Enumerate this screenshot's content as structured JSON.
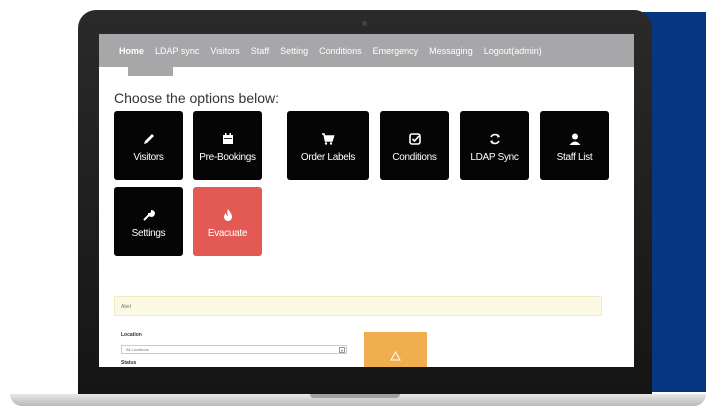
{
  "nav": {
    "items": [
      "Home",
      "LDAP sync",
      "Visitors",
      "Staff",
      "Setting",
      "Conditions",
      "Emergency",
      "Messaging",
      "Logout(admin)"
    ],
    "active": "Home"
  },
  "heading": "Choose the options below:",
  "tiles": [
    {
      "label": "Visitors",
      "icon": "pencil-icon"
    },
    {
      "label": "Pre-Bookings",
      "icon": "calendar-icon"
    },
    {
      "label": "Order Labels",
      "icon": "cart-icon"
    },
    {
      "label": "Conditions",
      "icon": "check-square-icon"
    },
    {
      "label": "LDAP Sync",
      "icon": "sync-icon"
    },
    {
      "label": "Staff List",
      "icon": "user-icon"
    },
    {
      "label": "Settings",
      "icon": "wrench-icon"
    },
    {
      "label": "Evacuate",
      "icon": "fire-icon"
    }
  ],
  "alert": "Alert",
  "form": {
    "location_label": "Location",
    "location_value": "All Locations",
    "second_label": "Status"
  },
  "colors": {
    "navbar": "#a7a7a9",
    "tile": "#050505",
    "evacuate": "#e35a55",
    "accent_blue": "#073780",
    "orange": "#f1ae4f"
  }
}
